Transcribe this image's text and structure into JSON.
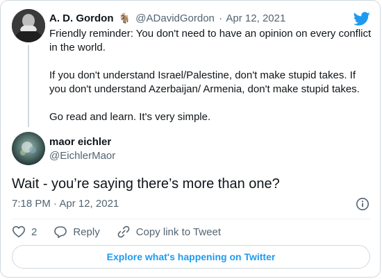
{
  "quoted_tweet": {
    "name": "A. D. Gordon",
    "emoji": "🐐",
    "handle": "@ADavidGordon",
    "separator": "·",
    "date": "Apr 12, 2021",
    "paragraphs": [
      "Friendly reminder: You don't need to have an opinion on every conflict in the world.",
      "If you don't understand Israel/Palestine, don't make stupid takes. If you don't understand Azerbaijan/ Armenia, don't make stupid takes.",
      "Go read and learn. It's very simple."
    ]
  },
  "tweet": {
    "name": "maor eichler",
    "handle": "@EichlerMaor",
    "text": "Wait - you’re saying there’s more than one?",
    "timestamp": "7:18 PM · Apr 12, 2021"
  },
  "actions": {
    "like_count": "2",
    "reply_label": "Reply",
    "copy_label": "Copy link to Tweet"
  },
  "explore_label": "Explore what's happening on Twitter",
  "colors": {
    "brand": "#1d9bf0",
    "text": "#0f1419",
    "secondary": "#536471",
    "border": "#cfd9de"
  },
  "icons": [
    "twitter-bird-icon",
    "info-icon",
    "heart-icon",
    "reply-icon",
    "link-icon"
  ]
}
